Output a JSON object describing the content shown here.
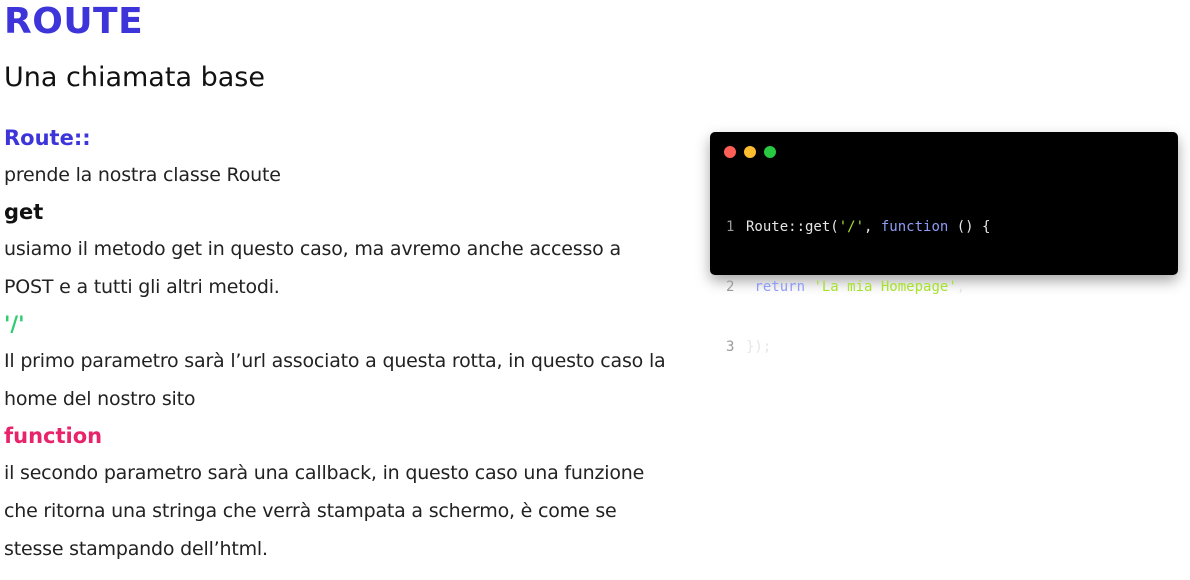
{
  "header": {
    "title": "ROUTE",
    "subtitle": "Una chiamata base"
  },
  "sections": [
    {
      "term": "Route::",
      "description": "prende la nostra classe Route"
    },
    {
      "term": "get",
      "description": "usiamo il metodo get in questo caso, ma avremo anche accesso a POST e a tutti gli altri metodi."
    },
    {
      "term": "'/'",
      "description": "Il primo parametro sarà l’url associato a questa rotta, in questo caso la home del nostro sito"
    },
    {
      "term": "function",
      "description": "il secondo parametro sarà una callback, in questo caso una funzione che ritorna una stringa che verrà stampata a schermo, è come se stesse stampando dell’html."
    }
  ],
  "code_window": {
    "lines": [
      {
        "number": "1",
        "tokens": [
          "Route::get(",
          "'/'",
          ", ",
          "function",
          " () {"
        ]
      },
      {
        "number": "2",
        "tokens": [
          " ",
          "return",
          " ",
          "'La mia Homepage'",
          ";"
        ]
      },
      {
        "number": "3",
        "tokens": [
          "});"
        ]
      }
    ]
  },
  "colors": {
    "title": "#3d35d9",
    "term_route": "#3d35d9",
    "term_get": "#111111",
    "term_slash": "#2ecc71",
    "term_function": "#e8236b",
    "code_background": "#000000",
    "dot_red": "#ff5f57",
    "dot_yellow": "#febc2e",
    "dot_green": "#28c840",
    "code_string": "#a6e22e",
    "code_keyword": "#8f9cf7"
  }
}
